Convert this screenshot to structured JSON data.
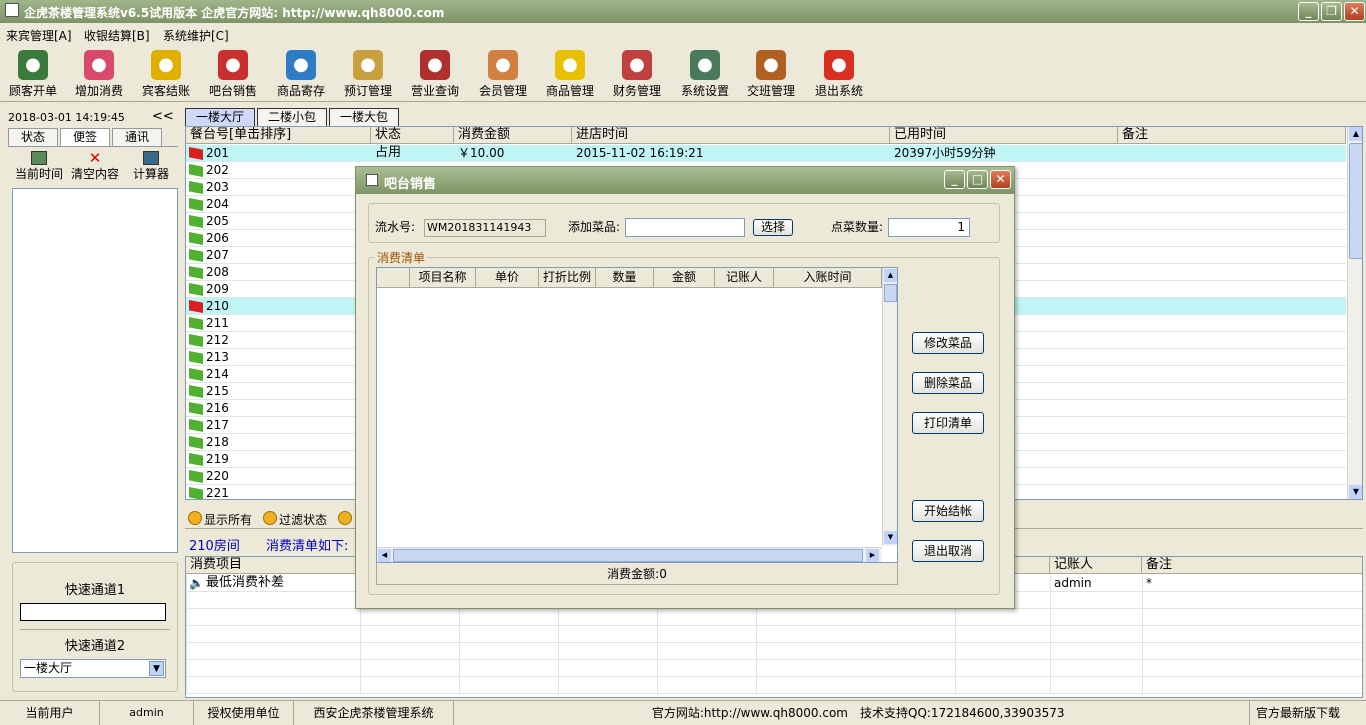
{
  "window": {
    "title": "企虎茶楼管理系统v6.5试用版本 企虎官方网站: http://www.qh8000.com"
  },
  "menu": [
    "来宾管理[A]",
    "收银结算[B]",
    "系统维护[C]"
  ],
  "toolbar": [
    {
      "label": "顾客开单",
      "icon": "teacup-icon",
      "color": "#3a7a3a"
    },
    {
      "label": "增加消费",
      "icon": "add-diamond-icon",
      "color": "#d94a6a"
    },
    {
      "label": "宾客结账",
      "icon": "arrow-right-icon",
      "color": "#e0b000"
    },
    {
      "label": "吧台销售",
      "icon": "bar-sale-icon",
      "color": "#c83030"
    },
    {
      "label": "商品寄存",
      "icon": "basket-icon",
      "color": "#2f7cc6"
    },
    {
      "label": "预订管理",
      "icon": "clock-icon",
      "color": "#c8a040"
    },
    {
      "label": "营业查询",
      "icon": "printer-icon",
      "color": "#b03030"
    },
    {
      "label": "会员管理",
      "icon": "members-icon",
      "color": "#d08040"
    },
    {
      "label": "商品管理",
      "icon": "star-icon",
      "color": "#e8c000"
    },
    {
      "label": "财务管理",
      "icon": "calculator-icon",
      "color": "#c04040"
    },
    {
      "label": "系统设置",
      "icon": "settings-icon",
      "color": "#4a7a5a"
    },
    {
      "label": "交班管理",
      "icon": "exit-door-icon",
      "color": "#b06020"
    },
    {
      "label": "退出系统",
      "icon": "power-icon",
      "color": "#d83020"
    }
  ],
  "left": {
    "datetime": "2018-03-01 14:19:45",
    "collapse": "<<",
    "tabs": [
      "状态",
      "便签",
      "通讯"
    ],
    "tools": [
      {
        "label": "当前时间",
        "icon": "calendar-icon"
      },
      {
        "label": "清空内容",
        "icon": "clear-x-icon"
      },
      {
        "label": "计算器",
        "icon": "calculator-icon"
      }
    ],
    "quick1_label": "快速通道1",
    "quick1_value": "",
    "quick2_label": "快速通道2",
    "quick2_value": "一楼大厅"
  },
  "floor_tabs": [
    "一楼大厅",
    "二楼小包",
    "一楼大包"
  ],
  "tables": {
    "headers": [
      "餐台号[单击排序]",
      "状态",
      "消费金额",
      "进店时间",
      "已用时间",
      "备注"
    ],
    "rows": [
      {
        "no": "201",
        "status": "占用",
        "amount": "￥10.00",
        "time": "2015-11-02 16:19:21",
        "used": "20397小时59分钟",
        "note": "",
        "occupied": true,
        "selected": true
      },
      {
        "no": "202"
      },
      {
        "no": "203"
      },
      {
        "no": "204"
      },
      {
        "no": "205"
      },
      {
        "no": "206"
      },
      {
        "no": "207"
      },
      {
        "no": "208"
      },
      {
        "no": "209"
      },
      {
        "no": "210",
        "occupied": true,
        "selected": true
      },
      {
        "no": "211"
      },
      {
        "no": "212"
      },
      {
        "no": "213"
      },
      {
        "no": "214"
      },
      {
        "no": "215"
      },
      {
        "no": "216"
      },
      {
        "no": "217"
      },
      {
        "no": "218"
      },
      {
        "no": "219"
      },
      {
        "no": "220"
      },
      {
        "no": "221"
      }
    ]
  },
  "filters": [
    "显示所有",
    "过滤状态"
  ],
  "room_info": "210房间",
  "consume_list": "消费清单如下:",
  "consume": {
    "headers": [
      "消费项目",
      "记账人",
      "备注"
    ],
    "rows": [
      {
        "item": "最低消费补差",
        "clerk": "admin",
        "note": "*"
      }
    ]
  },
  "dialog": {
    "title": "吧台销售",
    "serial_label": "流水号:",
    "serial_value": "WM201831141943",
    "add_label": "添加菜品:",
    "add_value": "",
    "select_btn": "选择",
    "qty_label": "点菜数量:",
    "qty_value": "1",
    "group_label": "消费清单",
    "columns": [
      "",
      "项目名称",
      "单价",
      "打折比例",
      "数量",
      "金额",
      "记账人",
      "入账时间"
    ],
    "total_label": "消费金额:",
    "total_value": "0",
    "buttons": [
      "修改菜品",
      "删除菜品",
      "打印清单",
      "开始结帐",
      "退出取消"
    ]
  },
  "status": {
    "user_label": "当前用户",
    "user": "admin",
    "auth_label": "授权使用单位",
    "company": "西安企虎茶楼管理系统",
    "website": "官方网站:http://www.qh8000.com",
    "support": "技术支持QQ:172184600,33903573",
    "download": "官方最新版下载"
  }
}
